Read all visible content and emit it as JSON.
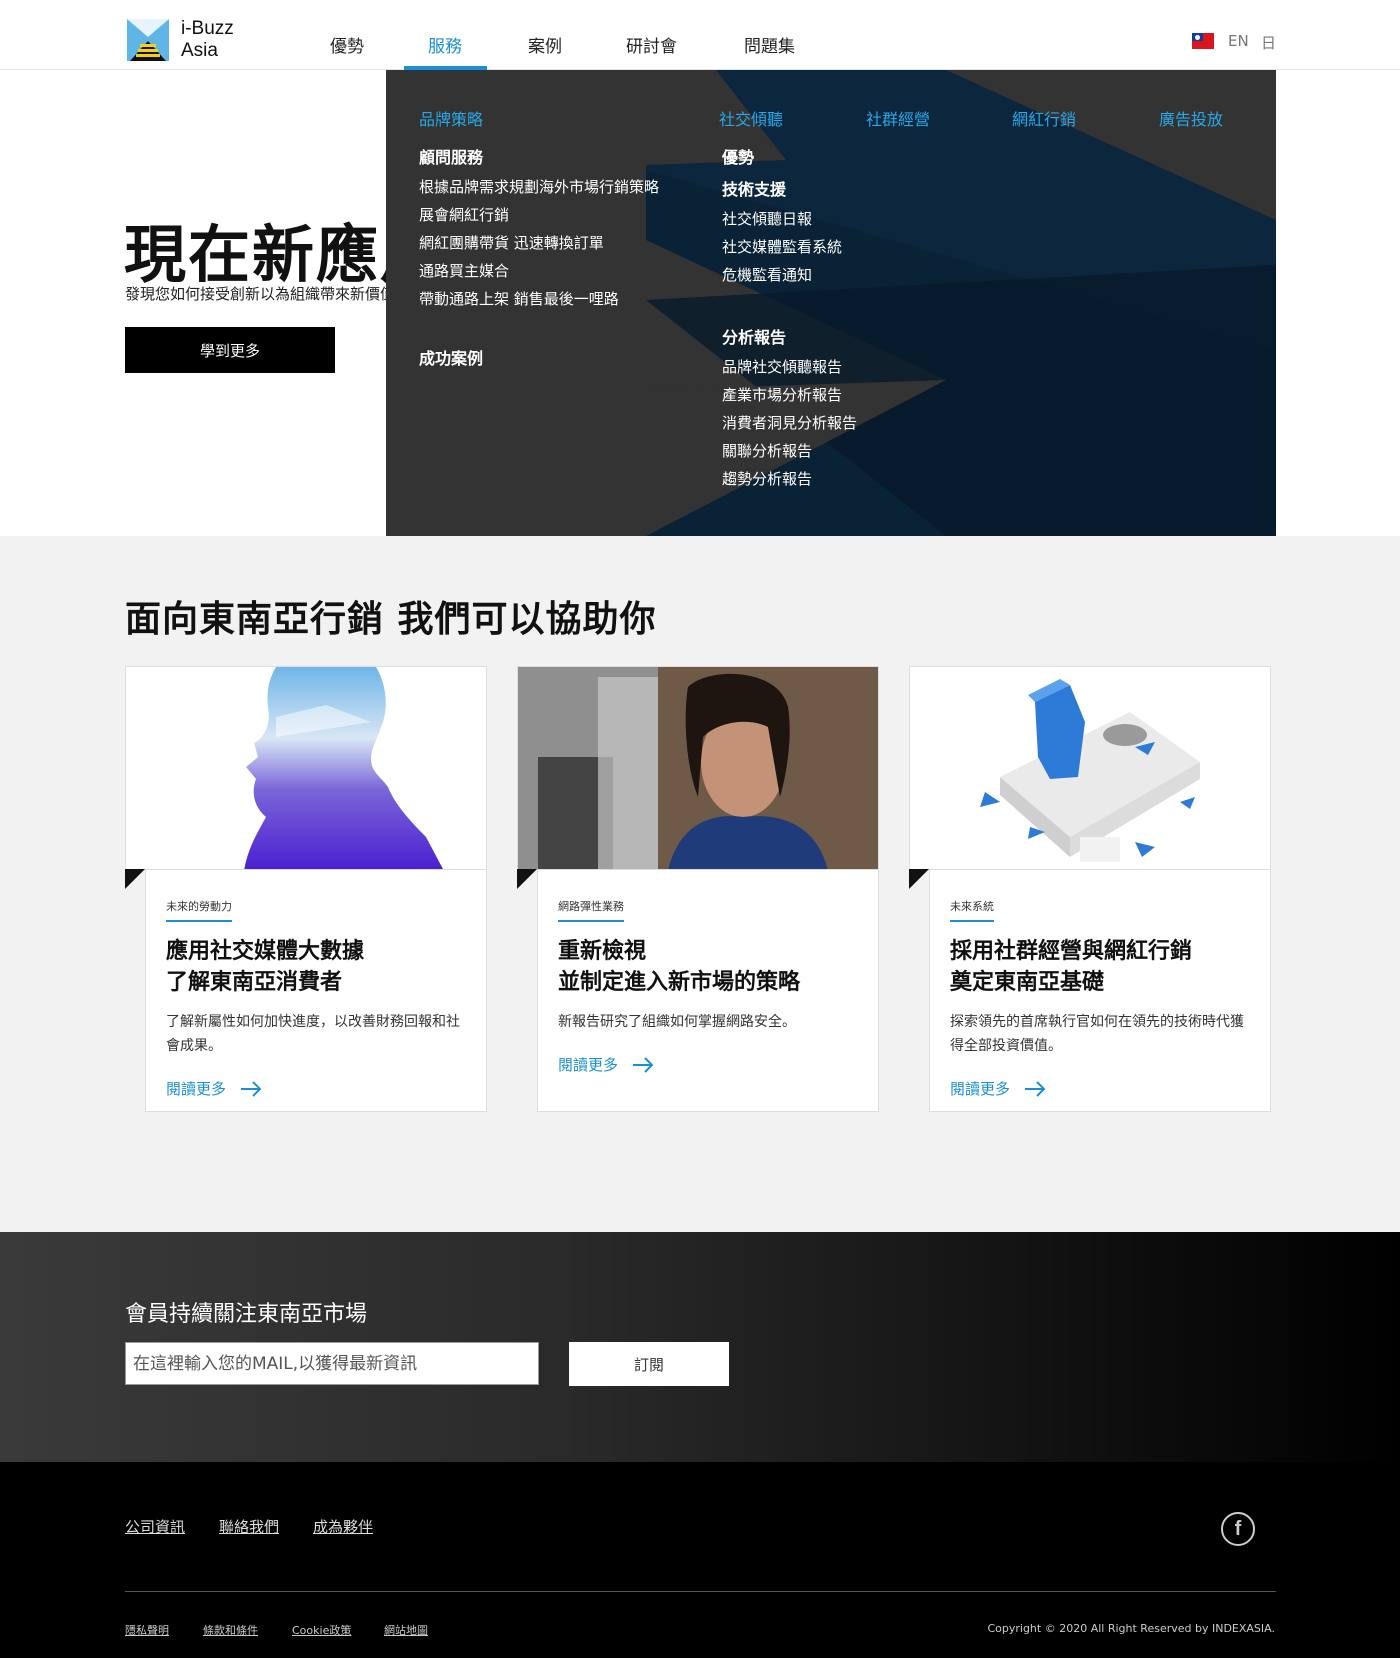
{
  "brand": {
    "logo_line1": "i-Buzz",
    "logo_line2": "Asia"
  },
  "nav": {
    "items": [
      "優勢",
      "服務",
      "案例",
      "研討會",
      "問題集"
    ],
    "active": "服務"
  },
  "languages": {
    "current_flag": "taiwan-flag-icon",
    "en": "EN",
    "ja": "日"
  },
  "hero": {
    "title": "現在新應用",
    "subtitle": "發現您如何接受創新以為組織帶來新價值",
    "button": "學到更多"
  },
  "mega_menu": {
    "col1": {
      "heading_link": "品牌策略",
      "section_title": "顧問服務",
      "items": [
        "根據品牌需求規劃海外市場行銷策略",
        "展會網紅行銷",
        "網紅團購帶貨  迅速轉換訂單",
        "通路買主媒合",
        "帶動通路上架 銷售最後一哩路"
      ],
      "cases_title": "成功案例"
    },
    "top_links": [
      "社交傾聽",
      "社群經營",
      "網紅行銷",
      "廣告投放"
    ],
    "col2": {
      "advantage_title": "優勢",
      "tech_title": "技術支援",
      "tech_items": [
        "社交傾聽日報",
        "社交媒體監看系統",
        "危機監看通知"
      ],
      "report_title": "分析報告",
      "report_items": [
        "品牌社交傾聽報告",
        "產業市場分析報告",
        "消費者洞見分析報告",
        "關聯分析報告",
        "趨勢分析報告"
      ]
    }
  },
  "section2": {
    "title": "面向東南亞行銷 我們可以協助你",
    "cards": [
      {
        "tag": "未來的勞動力",
        "title": "應用社交媒體大數據\n了解東南亞消費者",
        "desc": "了解新屬性如何加快進度，以改善財務回報和社會成果。",
        "link": "閱讀更多"
      },
      {
        "tag": "網路彈性業務",
        "title": "重新檢視\n並制定進入新市場的策略",
        "desc": "新報告研究了組織如何掌握網路安全。",
        "link": "閱讀更多"
      },
      {
        "tag": "未來系統",
        "title": "採用社群經營與網紅行銷\n奠定東南亞基礎",
        "desc": "探索領先的首席執行官如何在領先的技術時代獲得全部投資價值。",
        "link": "閱讀更多"
      }
    ]
  },
  "subscribe": {
    "title": "會員持續關注東南亞市場",
    "placeholder": "在這裡輸入您的MAIL,以獲得最新資訊",
    "button": "訂閱"
  },
  "footer": {
    "links": [
      "公司資訊",
      "聯絡我們",
      "成為夥伴"
    ],
    "legal": [
      "隱私聲明",
      "條款和條件",
      "Cookie政策",
      "網站地圖"
    ],
    "copyright": "Copyright © 2020 All Right Reserved by INDEXASIA.",
    "social_icon": "facebook-icon"
  },
  "colors": {
    "accent": "#1a8fd6",
    "menu_bg": "#333333",
    "menu_shape": "#0b2235"
  }
}
